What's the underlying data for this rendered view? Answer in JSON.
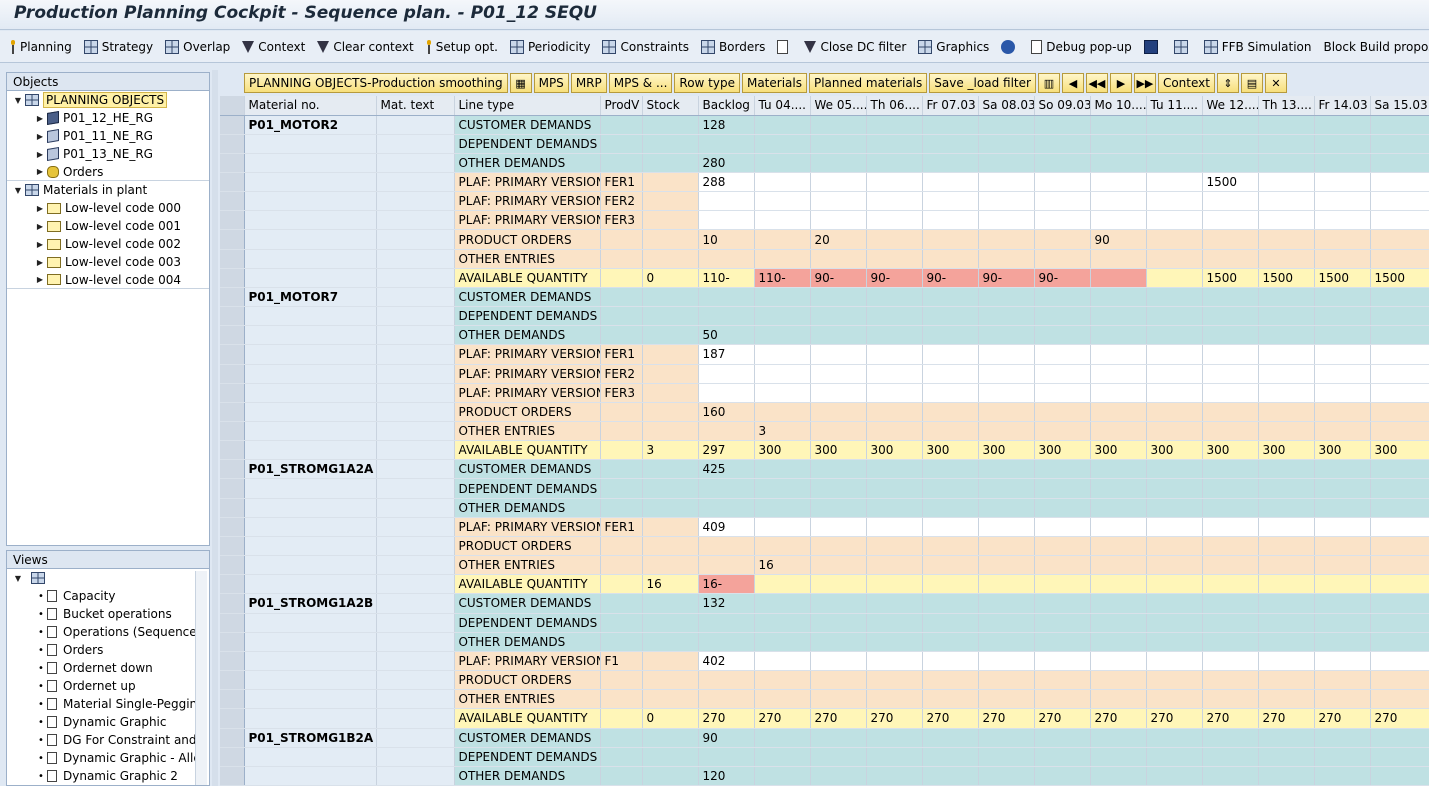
{
  "window": {
    "title": "Production Planning Cockpit - Sequence plan. - P01_12 SEQU"
  },
  "toolbar": [
    {
      "label": "Planning",
      "icon": "pin-icon"
    },
    {
      "label": "Strategy",
      "icon": "strategy-icon"
    },
    {
      "label": "Overlap",
      "icon": "overlap-icon"
    },
    {
      "label": "Context",
      "icon": "filter-icon"
    },
    {
      "label": "Clear context",
      "icon": "clear-filter-icon"
    },
    {
      "label": "Setup opt.",
      "icon": "pin-icon"
    },
    {
      "label": "Periodicity",
      "icon": "calendar-icon"
    },
    {
      "label": "Constraints",
      "icon": "constraints-icon"
    },
    {
      "label": "Borders",
      "icon": "borders-icon"
    },
    {
      "label": "",
      "icon": "document-icon"
    },
    {
      "label": "Close DC filter",
      "icon": "close-filter-icon"
    },
    {
      "label": "Graphics",
      "icon": "graphics-icon"
    },
    {
      "label": "",
      "icon": "refresh-icon"
    },
    {
      "label": "Debug pop-up",
      "icon": "debug-icon"
    },
    {
      "label": "",
      "icon": "close-box-icon"
    },
    {
      "label": "",
      "icon": "settings-icon"
    },
    {
      "label": "FFB Simulation",
      "icon": "simulation-icon"
    },
    {
      "label": "Block Build proposal",
      "icon": ""
    }
  ],
  "objects_panel": {
    "header": "Objects",
    "tree": [
      {
        "level": 0,
        "twisty": "▼",
        "icon": "grid",
        "label": "PLANNING OBJECTS",
        "highlight": true
      },
      {
        "level": 1,
        "twisty": "▶",
        "icon": "cube-filled",
        "label": "P01_12_HE_RG"
      },
      {
        "level": 1,
        "twisty": "▶",
        "icon": "cube",
        "label": "P01_11_NE_RG"
      },
      {
        "level": 1,
        "twisty": "▶",
        "icon": "cube",
        "label": "P01_13_NE_RG"
      },
      {
        "level": 1,
        "twisty": "▶",
        "icon": "orders",
        "label": "Orders",
        "sep": true
      },
      {
        "level": 0,
        "twisty": "▼",
        "icon": "plant",
        "label": "Materials in plant"
      },
      {
        "level": 1,
        "twisty": "▶",
        "icon": "folder",
        "label": "Low-level code 000"
      },
      {
        "level": 1,
        "twisty": "▶",
        "icon": "folder",
        "label": "Low-level code 001"
      },
      {
        "level": 1,
        "twisty": "▶",
        "icon": "folder",
        "label": "Low-level code 002"
      },
      {
        "level": 1,
        "twisty": "▶",
        "icon": "folder",
        "label": "Low-level code 003"
      },
      {
        "level": 1,
        "twisty": "▶",
        "icon": "folder",
        "label": "Low-level code 004",
        "sep": true
      }
    ]
  },
  "views_panel": {
    "header": "Views",
    "items": [
      "Capacity",
      "Bucket operations",
      "Operations (Sequence",
      "Orders",
      "Ordernet down",
      "Ordernet up",
      "Material Single-Pegging",
      "Dynamic Graphic",
      "DG For Constraint and",
      "Dynamic Graphic - Alle",
      "Dynamic Graphic 2"
    ]
  },
  "grid_toolbar": [
    {
      "label": "PLANNING OBJECTS-Production smoothing"
    },
    {
      "label": "",
      "icon": "hierarchy-icon"
    },
    {
      "label": "MPS"
    },
    {
      "label": "MRP"
    },
    {
      "label": "MPS & ..."
    },
    {
      "label": "Row type"
    },
    {
      "label": "Materials"
    },
    {
      "label": "Planned materials"
    },
    {
      "label": "Save _load filter"
    },
    {
      "label": "",
      "icon": "layout-icon"
    },
    {
      "label": "",
      "icon": "prev-icon"
    },
    {
      "label": "",
      "icon": "first-icon"
    },
    {
      "label": "",
      "icon": "next-icon"
    },
    {
      "label": "",
      "icon": "last-icon"
    },
    {
      "label": "Context"
    },
    {
      "label": "",
      "icon": "expand-icon"
    },
    {
      "label": "",
      "icon": "detail-icon"
    },
    {
      "label": "",
      "icon": "close-icon"
    }
  ],
  "grid": {
    "columns": [
      "Material no.",
      "Mat. text",
      "Line type",
      "ProdV",
      "Stock",
      "Backlog",
      "Tu 04....",
      "We 05....",
      "Th 06....",
      "Fr 07.03",
      "Sa 08.03",
      "So 09.03",
      "Mo 10....",
      "Tu 11....",
      "We 12....",
      "Th 13....",
      "Fr 14.03",
      "Sa 15.03"
    ],
    "rows": [
      {
        "mat": "P01_MOTOR2",
        "line": "CUSTOMER DEMANDS",
        "kind": "cust",
        "vals": [
          "",
          "",
          "128",
          "",
          "",
          "",
          "",
          "",
          "",
          "",
          "",
          "",
          "",
          "",
          ""
        ]
      },
      {
        "mat": "",
        "line": "DEPENDENT DEMANDS",
        "kind": "cust",
        "vals": [
          "",
          "",
          "",
          "",
          "",
          "",
          "",
          "",
          "",
          "",
          "",
          "",
          "",
          "",
          ""
        ]
      },
      {
        "mat": "",
        "line": "OTHER DEMANDS",
        "kind": "cust",
        "vals": [
          "",
          "",
          "280",
          "",
          "",
          "",
          "",
          "",
          "",
          "",
          "",
          "",
          "",
          "",
          ""
        ]
      },
      {
        "mat": "",
        "line": "PLAF: PRIMARY VERSION",
        "kind": "plaf",
        "pv": "FER1",
        "vals": [
          "",
          "288",
          "",
          "",
          "",
          "",
          "",
          "",
          "",
          "",
          "1500",
          "",
          "",
          ""
        ]
      },
      {
        "mat": "",
        "line": "PLAF: PRIMARY VERSION",
        "kind": "plaf",
        "pv": "FER2",
        "vals": [
          "",
          "",
          "",
          "",
          "",
          "",
          "",
          "",
          "",
          "",
          "",
          "",
          "",
          ""
        ]
      },
      {
        "mat": "",
        "line": "PLAF: PRIMARY VERSION",
        "kind": "plaf",
        "pv": "FER3",
        "vals": [
          "",
          "",
          "",
          "",
          "",
          "",
          "",
          "",
          "",
          "",
          "",
          "",
          "",
          ""
        ]
      },
      {
        "mat": "",
        "line": "PRODUCT ORDERS",
        "kind": "prod",
        "vals": [
          "",
          "",
          "10",
          "",
          "20",
          "",
          "",
          "",
          "",
          "90",
          "",
          "",
          "",
          "",
          ""
        ]
      },
      {
        "mat": "",
        "line": "OTHER ENTRIES",
        "kind": "prod",
        "vals": [
          "",
          "",
          "",
          "",
          "",
          "",
          "",
          "",
          "",
          "",
          "",
          "",
          "",
          "",
          ""
        ]
      },
      {
        "mat": "",
        "line": "AVAILABLE QUANTITY",
        "kind": "avail",
        "neg": [
          3,
          4,
          5,
          6,
          7,
          8,
          9
        ],
        "vals": [
          "",
          "0",
          "110-",
          "110-",
          "90-",
          "90-",
          "90-",
          "90-",
          "90-",
          "",
          "",
          "1500",
          "1500",
          "1500",
          "1500"
        ]
      },
      {
        "mat": "P01_MOTOR7",
        "line": "CUSTOMER DEMANDS",
        "kind": "cust",
        "vals": [
          "",
          "",
          "",
          "",
          "",
          "",
          "",
          "",
          "",
          "",
          "",
          "",
          "",
          "",
          ""
        ]
      },
      {
        "mat": "",
        "line": "DEPENDENT DEMANDS",
        "kind": "cust",
        "vals": [
          "",
          "",
          "",
          "",
          "",
          "",
          "",
          "",
          "",
          "",
          "",
          "",
          "",
          "",
          ""
        ]
      },
      {
        "mat": "",
        "line": "OTHER DEMANDS",
        "kind": "cust",
        "vals": [
          "",
          "",
          "50",
          "",
          "",
          "",
          "",
          "",
          "",
          "",
          "",
          "",
          "",
          "",
          ""
        ]
      },
      {
        "mat": "",
        "line": "PLAF: PRIMARY VERSION",
        "kind": "plaf",
        "pv": "FER1",
        "vals": [
          "",
          "187",
          "",
          "",
          "",
          "",
          "",
          "",
          "",
          "",
          "",
          "",
          "",
          ""
        ]
      },
      {
        "mat": "",
        "line": "PLAF: PRIMARY VERSION",
        "kind": "plaf",
        "pv": "FER2",
        "vals": [
          "",
          "",
          "",
          "",
          "",
          "",
          "",
          "",
          "",
          "",
          "",
          "",
          "",
          ""
        ]
      },
      {
        "mat": "",
        "line": "PLAF: PRIMARY VERSION",
        "kind": "plaf",
        "pv": "FER3",
        "vals": [
          "",
          "",
          "",
          "",
          "",
          "",
          "",
          "",
          "",
          "",
          "",
          "",
          "",
          ""
        ]
      },
      {
        "mat": "",
        "line": "PRODUCT ORDERS",
        "kind": "prod",
        "vals": [
          "",
          "",
          "160",
          "",
          "",
          "",
          "",
          "",
          "",
          "",
          "",
          "",
          "",
          "",
          ""
        ]
      },
      {
        "mat": "",
        "line": "OTHER ENTRIES",
        "kind": "prod",
        "vals": [
          "",
          "",
          "",
          "3",
          "",
          "",
          "",
          "",
          "",
          "",
          "",
          "",
          "",
          "",
          ""
        ]
      },
      {
        "mat": "",
        "line": "AVAILABLE QUANTITY",
        "kind": "avail",
        "vals": [
          "",
          "3",
          "297",
          "300",
          "300",
          "300",
          "300",
          "300",
          "300",
          "300",
          "300",
          "300",
          "300",
          "300",
          "300"
        ]
      },
      {
        "mat": "P01_STROMG1A2A",
        "line": "CUSTOMER DEMANDS",
        "kind": "cust",
        "vals": [
          "",
          "",
          "425",
          "",
          "",
          "",
          "",
          "",
          "",
          "",
          "",
          "",
          "",
          "",
          ""
        ]
      },
      {
        "mat": "",
        "line": "DEPENDENT DEMANDS",
        "kind": "cust",
        "vals": [
          "",
          "",
          "",
          "",
          "",
          "",
          "",
          "",
          "",
          "",
          "",
          "",
          "",
          "",
          ""
        ]
      },
      {
        "mat": "",
        "line": "OTHER DEMANDS",
        "kind": "cust",
        "vals": [
          "",
          "",
          "",
          "",
          "",
          "",
          "",
          "",
          "",
          "",
          "",
          "",
          "",
          "",
          ""
        ]
      },
      {
        "mat": "",
        "line": "PLAF: PRIMARY VERSION",
        "kind": "plaf",
        "pv": "FER1",
        "vals": [
          "",
          "409",
          "",
          "",
          "",
          "",
          "",
          "",
          "",
          "",
          "",
          "",
          "",
          ""
        ]
      },
      {
        "mat": "",
        "line": "PRODUCT ORDERS",
        "kind": "prod",
        "vals": [
          "",
          "",
          "",
          "",
          "",
          "",
          "",
          "",
          "",
          "",
          "",
          "",
          "",
          "",
          ""
        ]
      },
      {
        "mat": "",
        "line": "OTHER ENTRIES",
        "kind": "prod",
        "vals": [
          "",
          "",
          "",
          "16",
          "",
          "",
          "",
          "",
          "",
          "",
          "",
          "",
          "",
          "",
          ""
        ]
      },
      {
        "mat": "",
        "line": "AVAILABLE QUANTITY",
        "kind": "avail",
        "neg": [
          2
        ],
        "vals": [
          "",
          "16",
          "16-",
          "",
          "",
          "",
          "",
          "",
          "",
          "",
          "",
          "",
          "",
          "",
          ""
        ]
      },
      {
        "mat": "P01_STROMG1A2B",
        "line": "CUSTOMER DEMANDS",
        "kind": "cust",
        "vals": [
          "",
          "",
          "132",
          "",
          "",
          "",
          "",
          "",
          "",
          "",
          "",
          "",
          "",
          "",
          ""
        ]
      },
      {
        "mat": "",
        "line": "DEPENDENT DEMANDS",
        "kind": "cust",
        "vals": [
          "",
          "",
          "",
          "",
          "",
          "",
          "",
          "",
          "",
          "",
          "",
          "",
          "",
          "",
          ""
        ]
      },
      {
        "mat": "",
        "line": "OTHER DEMANDS",
        "kind": "cust",
        "vals": [
          "",
          "",
          "",
          "",
          "",
          "",
          "",
          "",
          "",
          "",
          "",
          "",
          "",
          "",
          ""
        ]
      },
      {
        "mat": "",
        "line": "PLAF: PRIMARY VERSION",
        "kind": "plaf",
        "pv": "F1",
        "vals": [
          "",
          "402",
          "",
          "",
          "",
          "",
          "",
          "",
          "",
          "",
          "",
          "",
          "",
          ""
        ]
      },
      {
        "mat": "",
        "line": "PRODUCT ORDERS",
        "kind": "prod",
        "vals": [
          "",
          "",
          "",
          "",
          "",
          "",
          "",
          "",
          "",
          "",
          "",
          "",
          "",
          "",
          ""
        ]
      },
      {
        "mat": "",
        "line": "OTHER ENTRIES",
        "kind": "prod",
        "vals": [
          "",
          "",
          "",
          "",
          "",
          "",
          "",
          "",
          "",
          "",
          "",
          "",
          "",
          "",
          ""
        ]
      },
      {
        "mat": "",
        "line": "AVAILABLE QUANTITY",
        "kind": "avail",
        "vals": [
          "",
          "0",
          "270",
          "270",
          "270",
          "270",
          "270",
          "270",
          "270",
          "270",
          "270",
          "270",
          "270",
          "270",
          "270"
        ]
      },
      {
        "mat": "P01_STROMG1B2A",
        "line": "CUSTOMER DEMANDS",
        "kind": "cust",
        "vals": [
          "",
          "",
          "90",
          "",
          "",
          "",
          "",
          "",
          "",
          "",
          "",
          "",
          "",
          "",
          ""
        ]
      },
      {
        "mat": "",
        "line": "DEPENDENT DEMANDS",
        "kind": "cust",
        "vals": [
          "",
          "",
          "",
          "",
          "",
          "",
          "",
          "",
          "",
          "",
          "",
          "",
          "",
          "",
          ""
        ]
      },
      {
        "mat": "",
        "line": "OTHER DEMANDS",
        "kind": "cust",
        "vals": [
          "",
          "",
          "120",
          "",
          "",
          "",
          "",
          "",
          "",
          "",
          "",
          "",
          "",
          "",
          ""
        ]
      }
    ]
  }
}
